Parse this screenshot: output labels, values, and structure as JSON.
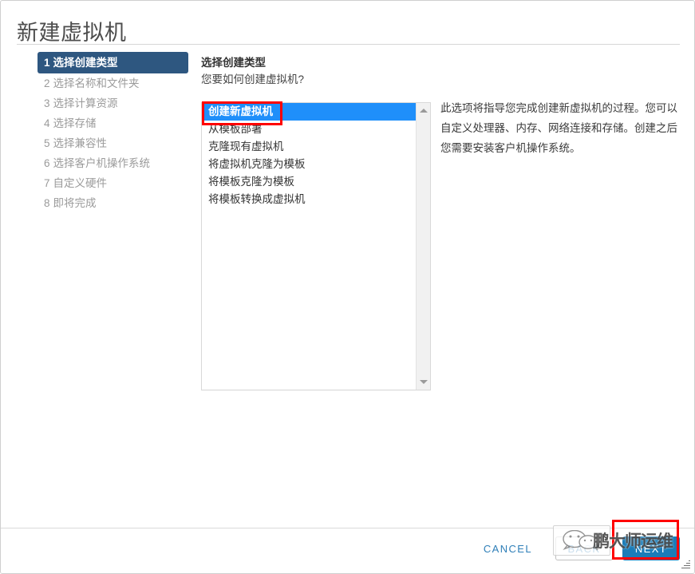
{
  "dialog": {
    "title": "新建虚拟机"
  },
  "sidebar": {
    "steps": [
      {
        "num": "1",
        "label": "选择创建类型",
        "active": true
      },
      {
        "num": "2",
        "label": "选择名称和文件夹",
        "active": false
      },
      {
        "num": "3",
        "label": "选择计算资源",
        "active": false
      },
      {
        "num": "4",
        "label": "选择存储",
        "active": false
      },
      {
        "num": "5",
        "label": "选择兼容性",
        "active": false
      },
      {
        "num": "6",
        "label": "选择客户机操作系统",
        "active": false
      },
      {
        "num": "7",
        "label": "自定义硬件",
        "active": false
      },
      {
        "num": "8",
        "label": "即将完成",
        "active": false
      }
    ]
  },
  "main": {
    "heading": "选择创建类型",
    "subheading": "您要如何创建虚拟机?",
    "options": [
      {
        "label": "创建新虚拟机",
        "selected": true
      },
      {
        "label": "从模板部署",
        "selected": false
      },
      {
        "label": "克隆现有虚拟机",
        "selected": false
      },
      {
        "label": "将虚拟机克隆为模板",
        "selected": false
      },
      {
        "label": "将模板克隆为模板",
        "selected": false
      },
      {
        "label": "将模板转换成虚拟机",
        "selected": false
      }
    ],
    "description": "此选项将指导您完成创建新虚拟机的过程。您可以自定义处理器、内存、网络连接和存储。创建之后您需要安装客户机操作系统。"
  },
  "footer": {
    "cancel_label": "CANCEL",
    "back_label": "BACK",
    "next_label": "NEXT"
  },
  "watermark": {
    "text": "鹏大师运维"
  },
  "colors": {
    "sidebar_active_bg": "#2e5780",
    "option_selected_bg": "#1f8ffa",
    "next_button_bg": "#1a7cb8",
    "link_blue": "#2f7fb8",
    "annotation_red": "#ff0000"
  }
}
